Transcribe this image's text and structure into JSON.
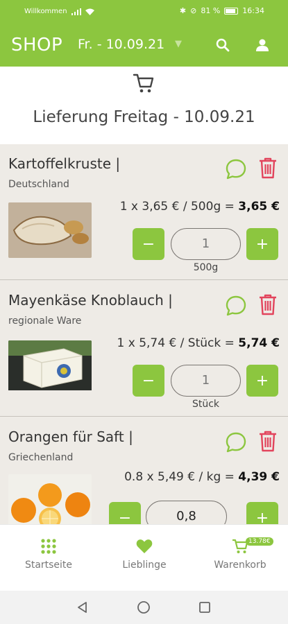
{
  "status": {
    "carrier": "Willkommen",
    "battery": "81 %",
    "time": "16:34"
  },
  "appbar": {
    "logo": "SHOP",
    "date": "Fr. - 10.09.21",
    "search_icon": "search-icon",
    "user_icon": "user-icon"
  },
  "delivery_title": "Lieferung Freitag - 10.09.21",
  "items": [
    {
      "name": "Kartoffelkruste |",
      "origin": "Deutschland",
      "price_calc": "1 x 3,65 € / 500g =",
      "total": "3,65 €",
      "qty": "1",
      "unit": "500g"
    },
    {
      "name": "Mayenkäse Knoblauch |",
      "origin": "regionale Ware",
      "price_calc": "1 x 5,74 € / Stück =",
      "total": "5,74 €",
      "qty": "1",
      "unit": "Stück"
    },
    {
      "name": "Orangen für Saft |",
      "origin": "Griechenland",
      "price_calc": "0.8 x 5,49 € / kg =",
      "total": "4,39 €",
      "qty": "0,8",
      "unit": ""
    }
  ],
  "controls": {
    "minus": "−",
    "plus": "+"
  },
  "nav": {
    "home": "Startseite",
    "favorites": "Lieblinge",
    "cart": "Warenkorb",
    "cart_badge": "13.78€"
  },
  "colors": {
    "accent": "#8cc63f",
    "danger": "#e2445c",
    "list_bg": "#eeebe6"
  }
}
